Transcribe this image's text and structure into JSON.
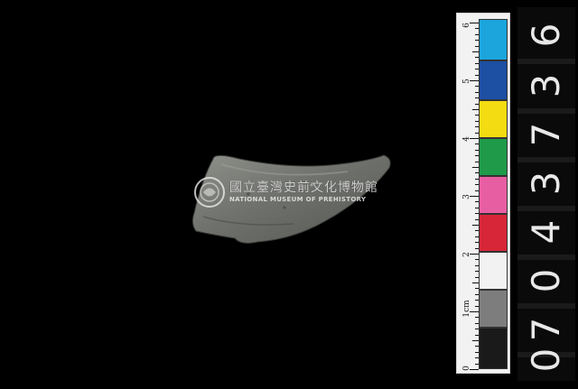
{
  "photo": {
    "subject": "stone-artifact-fragment"
  },
  "watermark": {
    "name_zh": "國立臺灣史前文化博物館",
    "name_en": "NATIONAL MUSEUM OF PREHISTORY"
  },
  "scale": {
    "ruler_labels": [
      "0",
      "1cm",
      "2",
      "3",
      "4",
      "5",
      "6"
    ],
    "swatches": [
      "#1a1a1a",
      "#7d7d7d",
      "#f2f2f2",
      "#d72638",
      "#e85ea3",
      "#1f9a49",
      "#f4dc12",
      "#1d4fa3",
      "#1ba5dc"
    ]
  },
  "accession": {
    "number": "0704373",
    "digits": [
      "0",
      "7",
      "0",
      "4",
      "3",
      "7",
      "3",
      "6"
    ]
  }
}
